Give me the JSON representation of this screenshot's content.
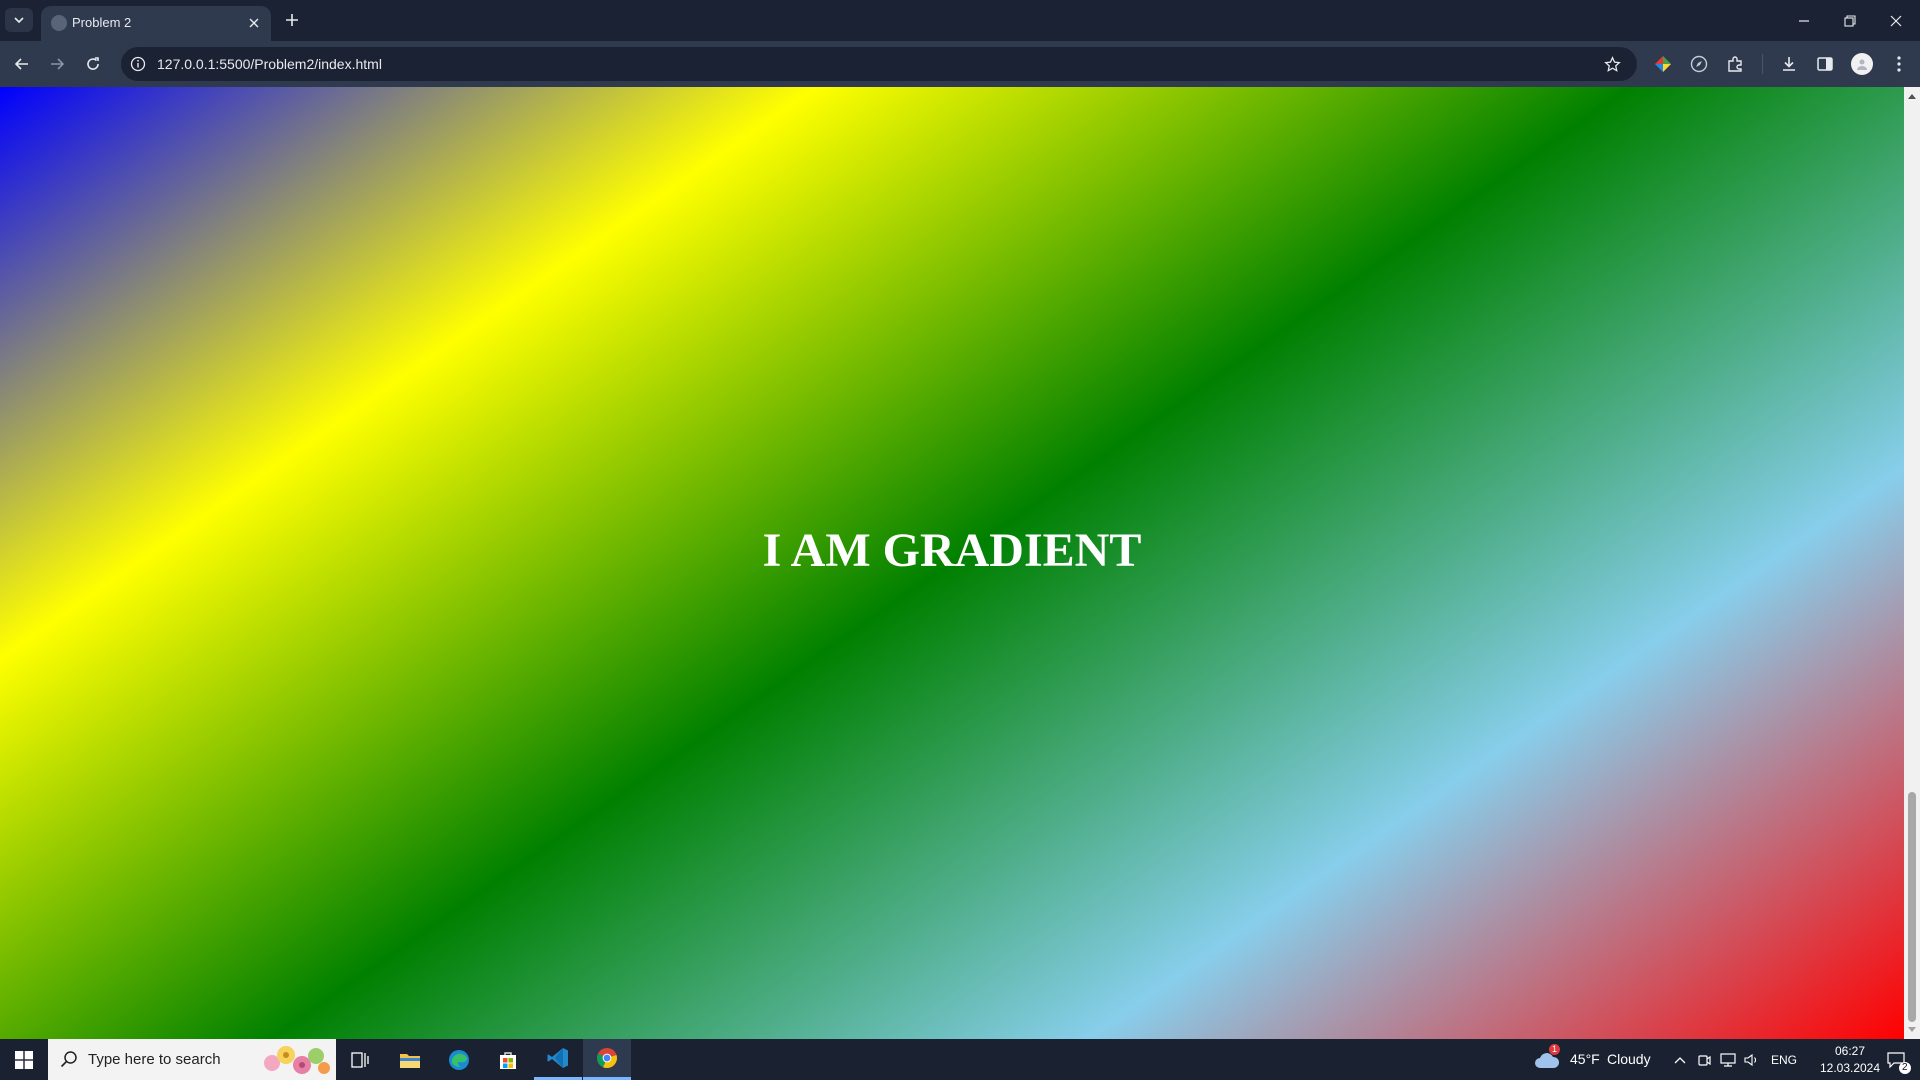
{
  "browser": {
    "tab_title": "Problem 2",
    "url": "127.0.0.1:5500/Problem2/index.html"
  },
  "page": {
    "heading": "I AM GRADIENT",
    "gradient_colors": [
      "#0000ff",
      "#ffff00",
      "#008000",
      "#87ceeb",
      "#ff0000"
    ],
    "gradient_direction": "top-left to bottom-right"
  },
  "taskbar": {
    "search_placeholder": "Type here to search",
    "weather_temp": "45°F",
    "weather_desc": "Cloudy",
    "weather_badge": "1",
    "language": "ENG",
    "time": "06:27",
    "date": "12.03.2024",
    "notification_count": "2"
  },
  "colors": {
    "chrome_dark": "#1b2233",
    "chrome_tab": "#2f3a4f",
    "accent": "#7ab7ff"
  }
}
